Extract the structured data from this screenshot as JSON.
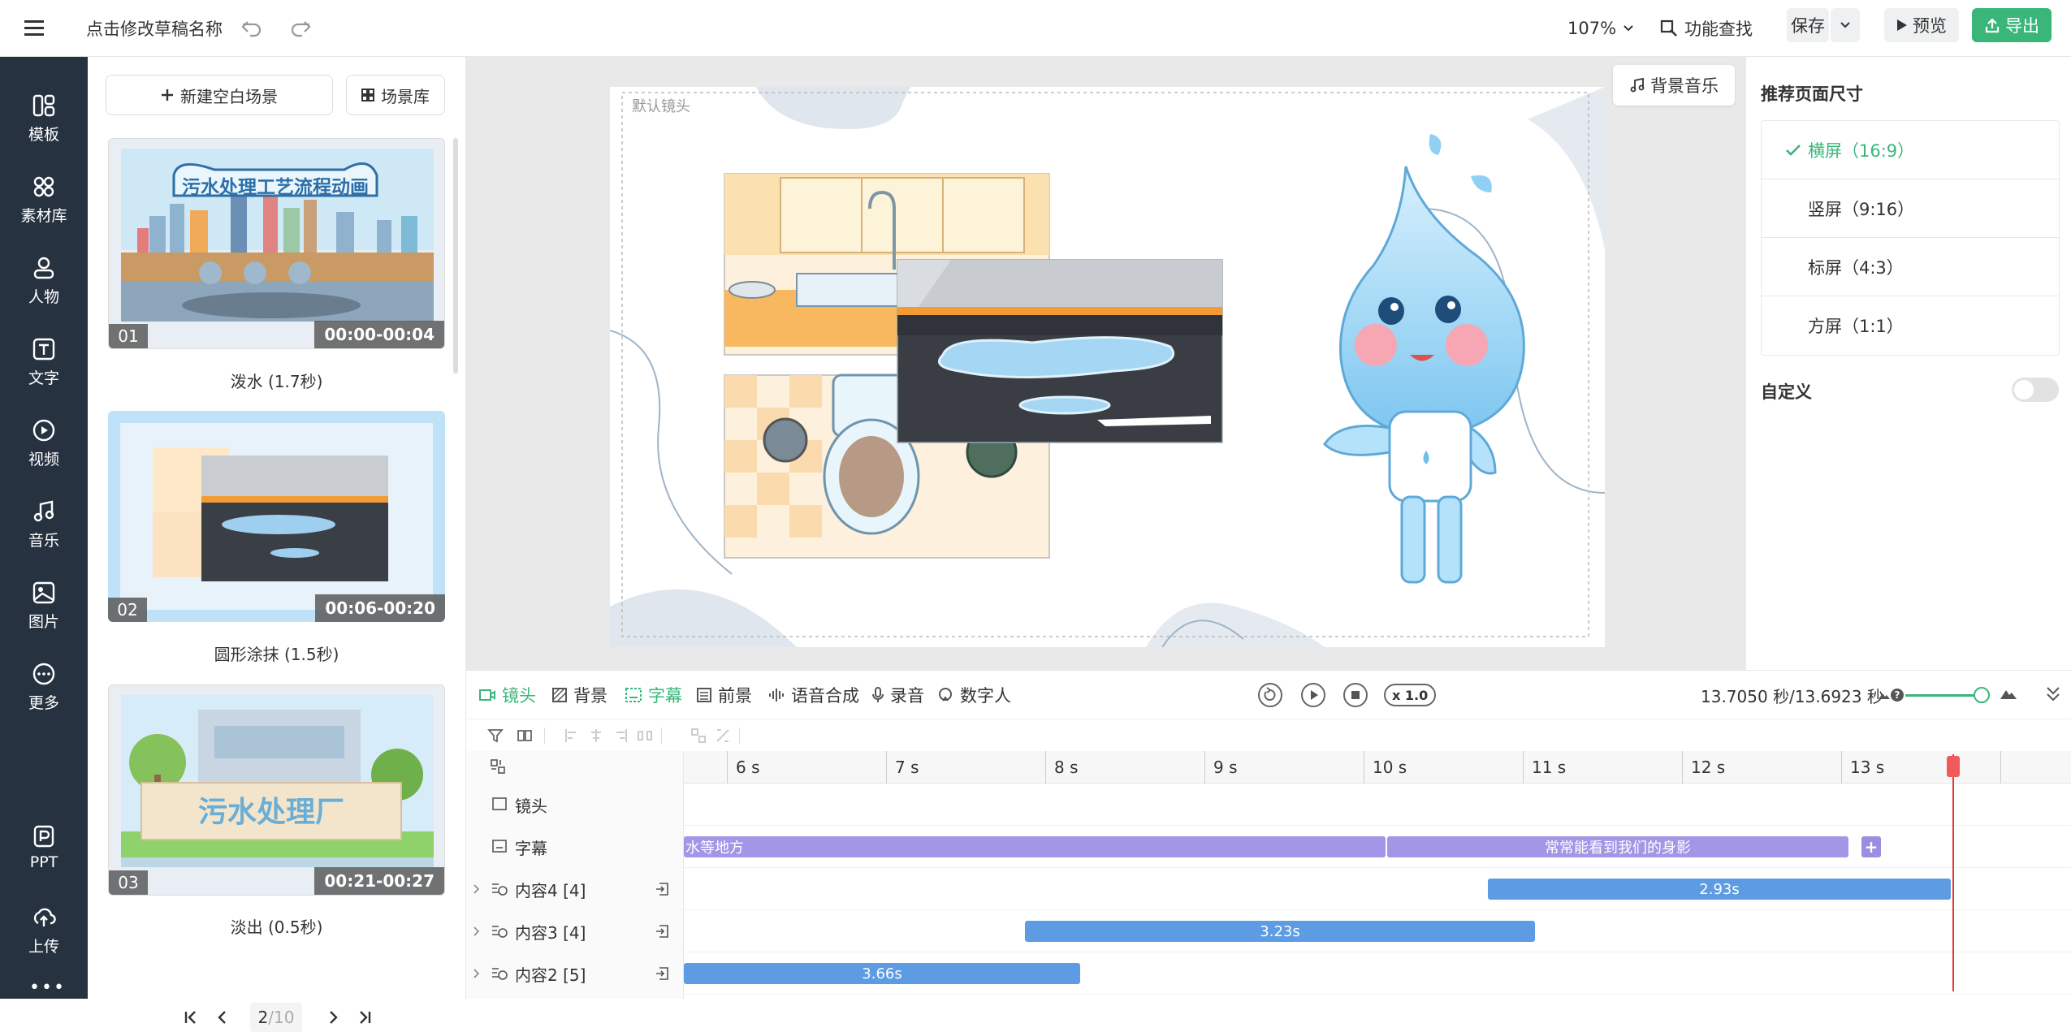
{
  "topbar": {
    "draft_name": "点击修改草稿名称",
    "zoom": "107%",
    "feature_search": "功能查找",
    "save": "保存",
    "preview": "预览",
    "export": "导出",
    "accent_color": "#3bb67a"
  },
  "rail": [
    {
      "label": "模板",
      "icon": "template-icon"
    },
    {
      "label": "素材库",
      "icon": "material-icon"
    },
    {
      "label": "人物",
      "icon": "person-icon"
    },
    {
      "label": "文字",
      "icon": "text-icon"
    },
    {
      "label": "视频",
      "icon": "video-icon"
    },
    {
      "label": "音乐",
      "icon": "music-icon"
    },
    {
      "label": "图片",
      "icon": "image-icon"
    },
    {
      "label": "更多",
      "icon": "more-icon"
    },
    {
      "label": "PPT",
      "icon": "ppt-icon"
    },
    {
      "label": "上传",
      "icon": "upload-icon"
    }
  ],
  "scenes": {
    "new_blank": "新建空白场景",
    "library": "场景库",
    "items": [
      {
        "num": "01",
        "time": "00:00-00:04",
        "caption": "泼水 (1.7秒)",
        "banner": "污水处理工艺流程动画"
      },
      {
        "num": "02",
        "time": "00:06-00:20",
        "caption": "圆形涂抹 (1.5秒)"
      },
      {
        "num": "03",
        "time": "00:21-00:27",
        "caption": "淡出 (0.5秒)",
        "banner": "污水处理厂"
      }
    ],
    "page": "2",
    "total": "/10"
  },
  "canvas": {
    "default_shot": "默认镜头",
    "bg_music": "背景音乐"
  },
  "right": {
    "title": "推荐页面尺寸",
    "options": [
      {
        "label": "横屏（16:9）",
        "selected": true
      },
      {
        "label": "竖屏（9:16）",
        "selected": false
      },
      {
        "label": "标屏（4:3）",
        "selected": false
      },
      {
        "label": "方屏（1:1）",
        "selected": false
      }
    ],
    "custom": "自定义"
  },
  "timeline": {
    "tabs": [
      "镜头",
      "背景",
      "字幕",
      "前景",
      "语音合成",
      "录音",
      "数字人"
    ],
    "speed": "x 1.0",
    "time_readout": "13.7050 秒/13.6923 秒",
    "ruler": [
      "6 s",
      "7 s",
      "8 s",
      "9 s",
      "10 s",
      "11 s",
      "12 s",
      "13 s"
    ],
    "tracks": [
      "镜头",
      "字幕",
      "内容4 [4]",
      "内容3 [4]",
      "内容2 [5]"
    ],
    "subtitle_clips": [
      "水等地方",
      "常常能看到我们的身影"
    ],
    "content_clips": [
      "2.93s",
      "3.23s",
      "3.66s"
    ],
    "playhead_seconds": 13.7
  }
}
